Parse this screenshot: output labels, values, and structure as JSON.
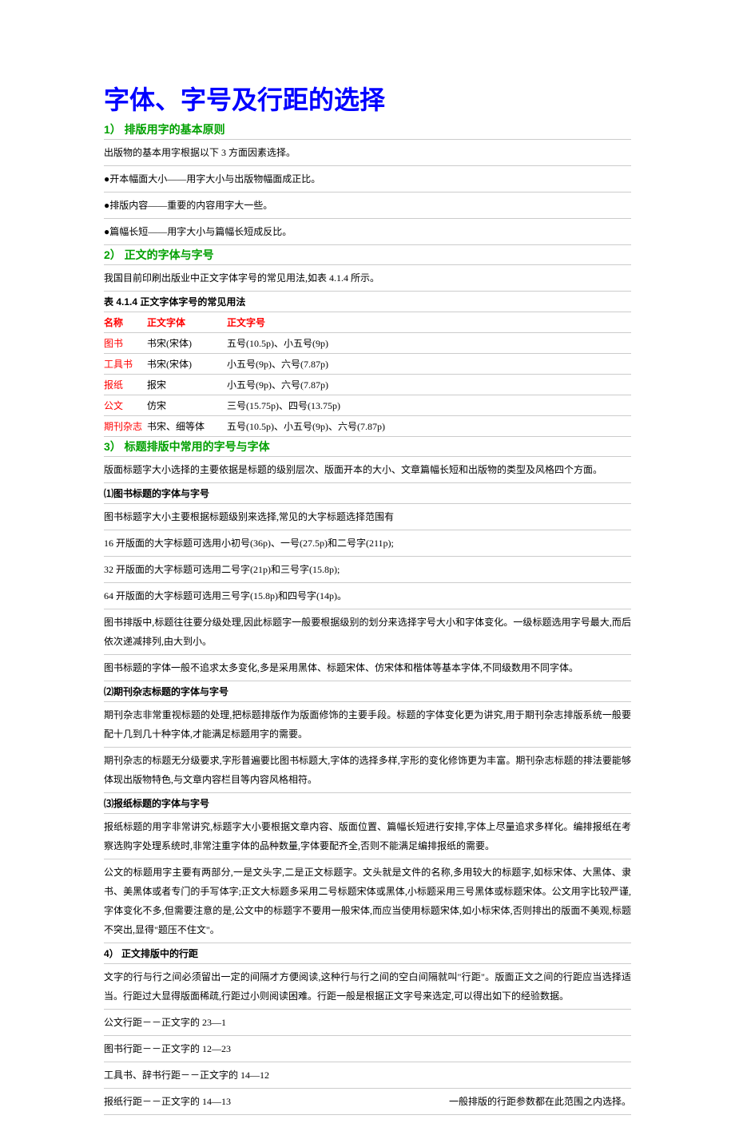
{
  "title": "字体、字号及行距的选择",
  "sec1": {
    "heading": "1） 排版用字的基本原则",
    "intro": "出版物的基本用字根据以下 3 方面因素选择。",
    "b1": "●开本幅面大小——用字大小与出版物幅面成正比。",
    "b2": "●排版内容——重要的内容用字大一些。",
    "b3": "●篇幅长短——用字大小与篇幅长短成反比。"
  },
  "sec2": {
    "heading": "2） 正文的字体与字号",
    "intro": "我国目前印刷出版业中正文字体字号的常见用法,如表 4.1.4 所示。",
    "caption": "表 4.1.4 正文字体字号的常见用法",
    "th": {
      "c1": "名称",
      "c2": "正文字体",
      "c3": "正文字号"
    },
    "rows": [
      {
        "c1": "图书",
        "c2": "书宋(宋体)",
        "c3": "五号(10.5p)、小五号(9p)"
      },
      {
        "c1": "工具书",
        "c2": "书宋(宋体)",
        "c3": "小五号(9p)、六号(7.87p)"
      },
      {
        "c1": "报纸",
        "c2": "报宋",
        "c3": "小五号(9p)、六号(7.87p)"
      },
      {
        "c1": "公文",
        "c2": "仿宋",
        "c3": "三号(15.75p)、四号(13.75p)"
      },
      {
        "c1": "期刊杂志",
        "c2": "书宋、细等体",
        "c3": "五号(10.5p)、小五号(9p)、六号(7.87p)"
      }
    ]
  },
  "sec3": {
    "heading": "3） 标题排版中常用的字号与字体",
    "intro": "版面标题字大小选择的主要依据是标题的级别层次、版面开本的大小、文章篇幅长短和出版物的类型及风格四个方面。",
    "sub1": {
      "heading": "⑴图书标题的字体与字号",
      "p1": "图书标题字大小主要根据标题级别来选择,常见的大字标题选择范围有",
      "p2": "16 开版面的大字标题可选用小初号(36p)、一号(27.5p)和二号字(211p);",
      "p3": "32 开版面的大字标题可选用二号字(21p)和三号字(15.8p);",
      "p4": "64 开版面的大字标题可选用三号字(15.8p)和四号字(14p)。",
      "p5": "图书排版中,标题往往要分级处理,因此标题字一般要根据级别的划分来选择字号大小和字体变化。一级标题选用字号最大,而后依次递减排列,由大到小。",
      "p6": "图书标题的字体一般不追求太多变化,多是采用黑体、标题宋体、仿宋体和楷体等基本字体,不同级数用不同字体。"
    },
    "sub2": {
      "heading": "⑵期刊杂志标题的字体与字号",
      "p1": "期刊杂志非常重视标题的处理,把标题排版作为版面修饰的主要手段。标题的字体变化更为讲究,用于期刊杂志排版系统一般要配十几到几十种字体,才能满足标题用字的需要。",
      "p2": "期刊杂志的标题无分级要求,字形普遍要比图书标题大,字体的选择多样,字形的变化修饰更为丰富。期刊杂志标题的排法要能够体现出版物特色,与文章内容栏目等内容风格相符。"
    },
    "sub3": {
      "heading": "⑶报纸标题的字体与字号",
      "p1": "报纸标题的用字非常讲究,标题字大小要根据文章内容、版面位置、篇幅长短进行安排,字体上尽量追求多样化。编排报纸在考察选购字处理系统时,非常注重字体的品种数量,字体要配齐全,否则不能满足编排报纸的需要。",
      "p2": "公文的标题用字主要有两部分,一是文头字,二是正文标题字。文头就是文件的名称,多用较大的标题字,如标宋体、大黑体、隶书、美黑体或者专门的手写体字;正文大标题多采用二号标题宋体或黑体,小标题采用三号黑体或标题宋体。公文用字比较严谨,字体变化不多,但需要注意的是,公文中的标题字不要用一般宋体,而应当使用标题宋体,如小标宋体,否则排出的版面不美观,标题不突出,显得\"题压不住文\"。"
    }
  },
  "sec4": {
    "heading": "4） 正文排版中的行距",
    "intro": "文字的行与行之间必须留出一定的间隔才方便阅读,这种行与行之间的空白间隔就叫\"行距\"。版面正文之间的行距应当选择适当。行距过大显得版面稀疏,行距过小则阅读困难。行距一般是根据正文字号来选定,可以得出如下的经验数据。",
    "r1": "公文行距－－正文字的 23—1",
    "r2": "图书行距－－正文字的 12—23",
    "r3": "工具书、辞书行距－－正文字的 14—12",
    "r4a": "报纸行距－－正文字的 14—13",
    "r4b": "一般排版的行距参数都在此范围之内选择。"
  }
}
